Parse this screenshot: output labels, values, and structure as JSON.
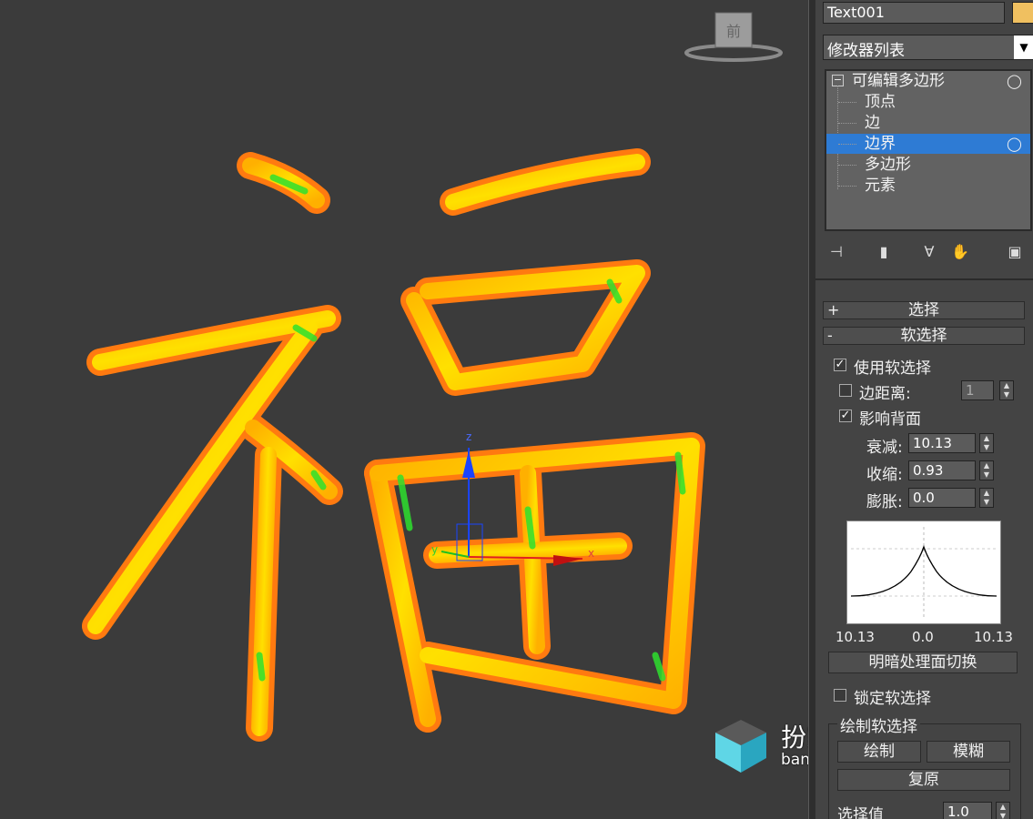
{
  "panel": {
    "object_name": "Text001",
    "modifier_list": "修改器列表",
    "stack": {
      "root": "可编辑多边形",
      "items": [
        "顶点",
        "边",
        "边界",
        "多边形",
        "元素"
      ],
      "selected_index": 2
    },
    "rollouts": {
      "select_label": "选择",
      "select_sign": "+",
      "soft_label": "软选择",
      "soft_sign": "-"
    },
    "soft_selection": {
      "use_soft": {
        "label": "使用软选择",
        "checked": true
      },
      "edge_distance": {
        "label": "边距离:",
        "checked": false,
        "value": "1"
      },
      "affect_backfacing": {
        "label": "影响背面",
        "checked": true
      },
      "falloff": {
        "label": "衰减:",
        "value": "10.13"
      },
      "pinch": {
        "label": "收缩:",
        "value": "0.93"
      },
      "bubble": {
        "label": "膨胀:",
        "value": "0.0"
      },
      "curve_labels": [
        "10.13",
        "0.0",
        "10.13"
      ],
      "shaded_face_toggle": "明暗处理面切换",
      "lock_soft": {
        "label": "锁定软选择",
        "checked": false
      },
      "paint_soft_label": "绘制软选择",
      "paint_button": "绘制",
      "blur_button": "模糊",
      "revert_button": "复原",
      "selection_value": {
        "label": "选择值",
        "value": "1.0"
      }
    }
  },
  "watermark": {
    "title": "扮家家室内设计",
    "url": "banjiajia.com"
  },
  "viewport": {
    "glyph": "福",
    "gizmo": {
      "x": "x",
      "y": "y",
      "z": "z"
    },
    "viewcube_label": "前"
  },
  "colors": {
    "viewport_bg": "#3b3b3b",
    "panel_bg": "#444444",
    "selection_blue": "#2e7bd4",
    "glyph_outer": "#ff8c1a",
    "glyph_mid": "#ffd000",
    "glyph_hot": "#33e633"
  }
}
